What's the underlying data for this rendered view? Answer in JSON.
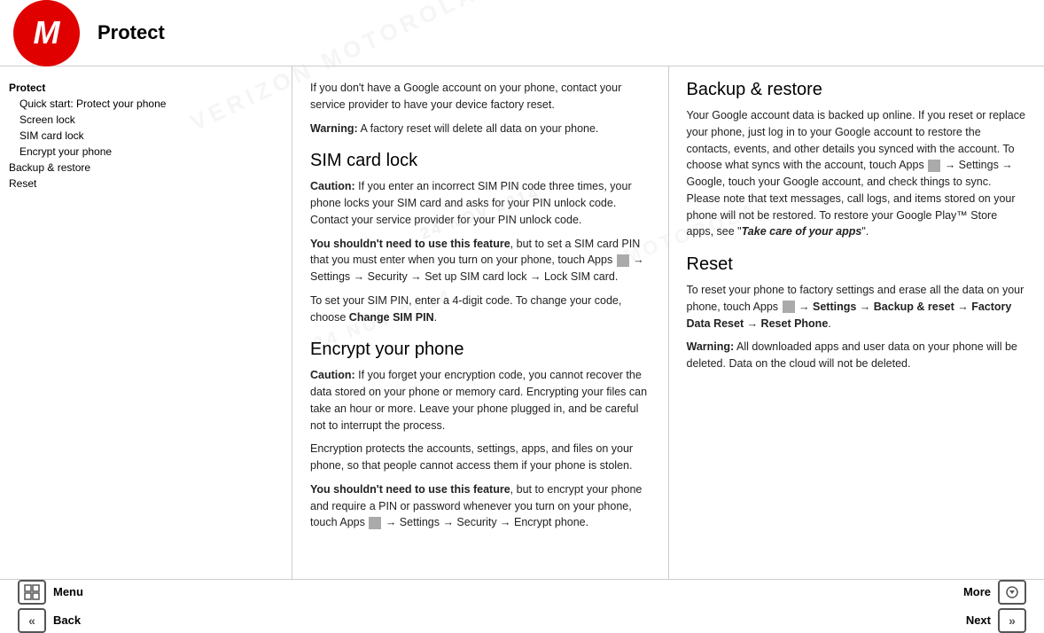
{
  "header": {
    "title": "Protect",
    "logo_letter": "M"
  },
  "sidebar": {
    "items": [
      {
        "label": "Protect",
        "class": "current",
        "indent": 0
      },
      {
        "label": "Quick start: Protect your phone",
        "class": "",
        "indent": 1
      },
      {
        "label": "Screen lock",
        "class": "",
        "indent": 1
      },
      {
        "label": "SIM card lock",
        "class": "",
        "indent": 1
      },
      {
        "label": "Encrypt your phone",
        "class": "",
        "indent": 1
      },
      {
        "label": "Backup & restore",
        "class": "",
        "indent": 0
      },
      {
        "label": "Reset",
        "class": "",
        "indent": 0
      }
    ]
  },
  "content_left": {
    "intro_p": "If you don't have a Google account on your phone, contact your service provider to have your device factory reset.",
    "warning_label": "Warning:",
    "warning_text": " A factory reset will delete all data on your phone.",
    "sim_title": "SIM card lock",
    "sim_caution_label": "Caution:",
    "sim_caution_text": " If you enter an incorrect SIM PIN code three times, your phone locks your SIM card and asks for your PIN unlock code. Contact your service provider for your PIN unlock code.",
    "sim_need_label": "You shouldn't need to use this feature",
    "sim_need_text": ", but to set a SIM card PIN that you must enter when you turn on your phone, touch Apps",
    "sim_need_text2": " → Settings → Security → Set up SIM card lock → Lock SIM card.",
    "sim_pin_text": "To set your SIM PIN, enter a 4-digit code. To change your code, choose",
    "sim_pin_bold": " Change SIM PIN",
    "sim_pin_end": ".",
    "encrypt_title": "Encrypt your phone",
    "encrypt_caution_label": "Caution:",
    "encrypt_caution_text": " If you forget your encryption code, you cannot recover the data stored on your phone or memory card. Encrypting your files can take an hour or more. Leave your phone plugged in, and be careful not to interrupt the process.",
    "encrypt_p2": "Encryption protects the accounts, settings, apps, and files on your phone, so that people cannot access them if your phone is stolen.",
    "encrypt_need_label": "You shouldn't need to use this feature",
    "encrypt_need_text": ", but to encrypt your phone and require a PIN or password whenever you turn on your phone, touch Apps",
    "encrypt_need_text2": " → Settings → Security → Encrypt phone."
  },
  "content_right": {
    "backup_title": "Backup & restore",
    "backup_p1": "Your Google account data is backed up online. If you reset or replace your phone, just log in to your Google account to restore the contacts, events, and other details you synced with the account. To choose what syncs with the account, touch Apps",
    "backup_p1b": " → Settings → Google, touch your Google account, and check things to sync. Please note that text messages, call logs, and items stored on your phone will not be restored. To restore your Google Play™ Store apps, see \"",
    "backup_p1c": "Take care of your apps",
    "backup_p1d": "\".",
    "reset_title": "Reset",
    "reset_p1": "To reset your phone to factory settings and erase all the data on your phone, touch Apps",
    "reset_p1b": " → Settings → Backup & reset → Factory Data Reset → Reset Phone",
    "reset_p1c": ".",
    "reset_warning_label": "Warning:",
    "reset_warning_text": " All downloaded apps and user data on your phone will be deleted. Data on the cloud will not be deleted.",
    "apps_label": "Apps"
  },
  "footer": {
    "menu_label": "Menu",
    "more_label": "More",
    "back_label": "Back",
    "next_label": "Next",
    "menu_icon": "⊞",
    "back_icon": "«",
    "more_icon": "▽",
    "next_icon": "»"
  },
  "watermarks": {
    "date1": "24 NOV 2014",
    "stamp1": "VERIZON MOTOROLA",
    "stamp2": "24 NOV 2014",
    "stamp3": "MOTOROLA",
    "stamp4": "MOTOROLA"
  }
}
